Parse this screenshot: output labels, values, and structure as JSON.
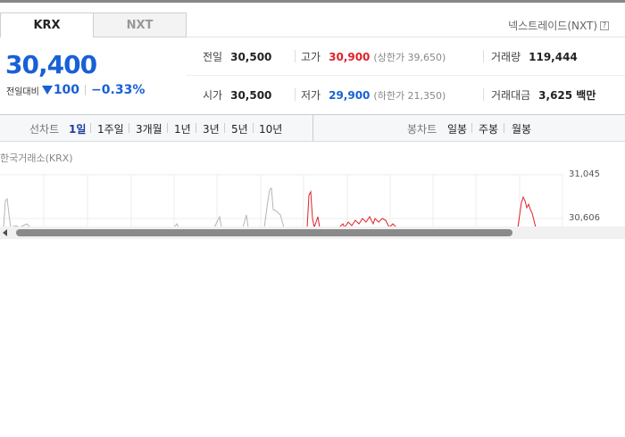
{
  "market_tabs": [
    {
      "label": "KRX",
      "active": true
    },
    {
      "label": "NXT",
      "active": false
    }
  ],
  "nxt_link": {
    "label": "넥스트레이드(NXT)",
    "help": "?"
  },
  "quote": {
    "price": "30,400",
    "change_label": "전일대비",
    "change_amount": "100",
    "change_rate": "−0.33%",
    "direction": "down"
  },
  "stats": {
    "prev_close": {
      "label": "전일",
      "value": "30,500"
    },
    "high": {
      "label": "고가",
      "value": "30,900",
      "sub": "(상한가 39,650)"
    },
    "volume": {
      "label": "거래량",
      "value": "119,444"
    },
    "open": {
      "label": "시가",
      "value": "30,500"
    },
    "low": {
      "label": "저가",
      "value": "29,900",
      "sub": "(하한가 21,350)"
    },
    "amount": {
      "label": "거래대금",
      "value": "3,625 백만"
    }
  },
  "toolbar": {
    "line_label": "선차트",
    "periods": [
      "1일",
      "1주일",
      "3개월",
      "1년",
      "3년",
      "5년",
      "10년"
    ],
    "active_period": "1일",
    "candle_label": "봉차트",
    "candle_periods": [
      "일봉",
      "주봉",
      "월봉"
    ]
  },
  "chart": {
    "exchange_label": "한국거래소(KRX)",
    "y_ticks": [
      "31,045",
      "30,606"
    ]
  },
  "colors": {
    "up": "#e0212a",
    "down": "#1860d6",
    "active_period": "#1a3e9c"
  },
  "icons": {
    "help": "question-box-icon",
    "scroll_left": "triangle-left-icon"
  }
}
